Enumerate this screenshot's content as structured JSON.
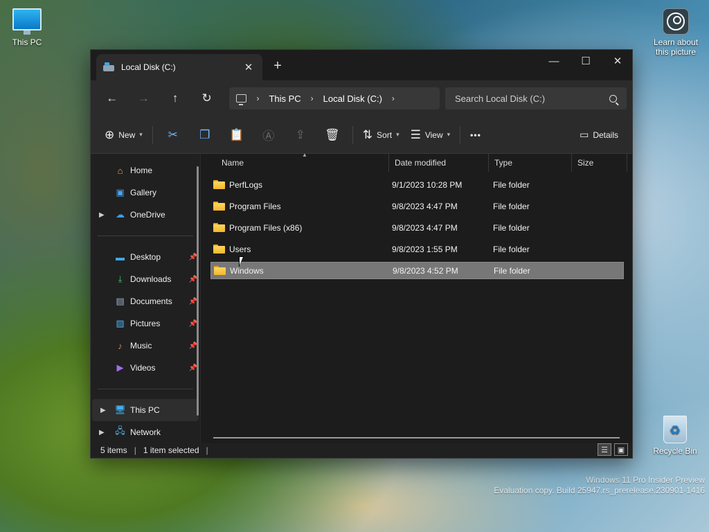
{
  "desktop": {
    "this_pc_label": "This PC",
    "learn_label": "Learn about this picture",
    "recycle_label": "Recycle Bin",
    "watermark_line1": "Windows 11 Pro Insider Preview",
    "watermark_line2": "Evaluation copy. Build 25947.rs_prerelease.230901-1416"
  },
  "window": {
    "tab_title": "Local Disk (C:)",
    "tab_close": "✕",
    "new_tab": "+",
    "minimize": "—",
    "maximize": "☐",
    "close": "✕"
  },
  "nav": {
    "back": "←",
    "forward": "→",
    "up": "↑",
    "refresh": "↻",
    "breadcrumb": [
      "This PC",
      "Local Disk (C:)"
    ],
    "crumb_sep": "›",
    "search_placeholder": "Search Local Disk (C:)"
  },
  "commands": {
    "new_label": "New",
    "sort_label": "Sort",
    "view_label": "View",
    "more_label": "•••",
    "details_label": "Details"
  },
  "sidebar": {
    "home": "Home",
    "gallery": "Gallery",
    "onedrive": "OneDrive",
    "desktop": "Desktop",
    "downloads": "Downloads",
    "documents": "Documents",
    "pictures": "Pictures",
    "music": "Music",
    "videos": "Videos",
    "this_pc": "This PC",
    "network": "Network"
  },
  "columns": {
    "name": "Name",
    "date": "Date modified",
    "type": "Type",
    "size": "Size"
  },
  "files": [
    {
      "name": "PerfLogs",
      "date": "9/1/2023 10:28 PM",
      "type": "File folder"
    },
    {
      "name": "Program Files",
      "date": "9/8/2023 4:47 PM",
      "type": "File folder"
    },
    {
      "name": "Program Files (x86)",
      "date": "9/8/2023 4:47 PM",
      "type": "File folder"
    },
    {
      "name": "Users",
      "date": "9/8/2023 1:55 PM",
      "type": "File folder"
    },
    {
      "name": "Windows",
      "date": "9/8/2023 4:52 PM",
      "type": "File folder"
    }
  ],
  "status": {
    "items": "5 items",
    "selected": "1 item selected"
  },
  "colors": {
    "window_bg": "#202020",
    "selection": "#777777",
    "folder_yellow": "#f2b730",
    "accent_blue": "#6fb8ff"
  }
}
